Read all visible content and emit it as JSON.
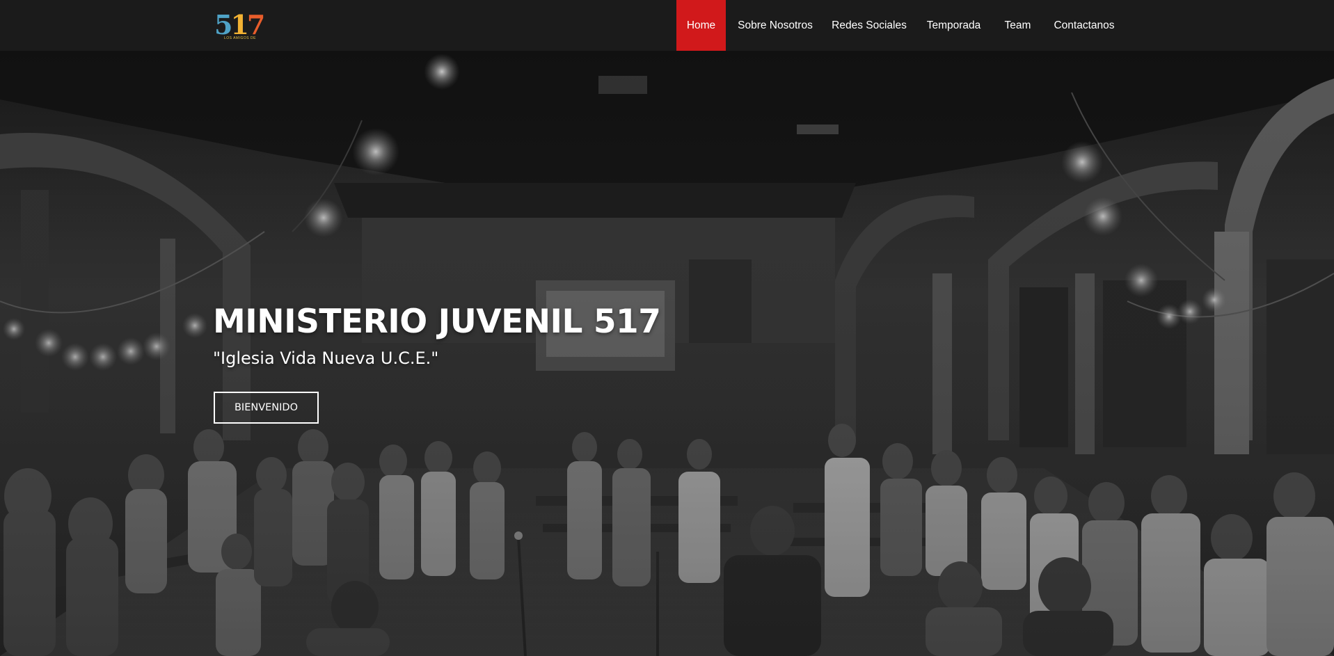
{
  "logo": {
    "digit_5": "5",
    "digit_1": "1",
    "digit_7": "7",
    "tagline": "LOS AMIGOS DE"
  },
  "nav": {
    "items": [
      {
        "label": "Home",
        "active": true
      },
      {
        "label": "Sobre Nosotros",
        "active": false
      },
      {
        "label": "Redes Sociales",
        "active": false
      },
      {
        "label": "Temporada",
        "active": false
      },
      {
        "label": "Team",
        "active": false
      },
      {
        "label": "Contactanos",
        "active": false
      }
    ]
  },
  "hero": {
    "title": "MINISTERIO JUVENIL 517",
    "subtitle": "\"Iglesia Vida Nueva U.C.E.\"",
    "button_label": "BIENVENIDO"
  },
  "colors": {
    "navbar_bg": "#1b1b1b",
    "accent": "#d1191b",
    "text": "#ffffff"
  }
}
